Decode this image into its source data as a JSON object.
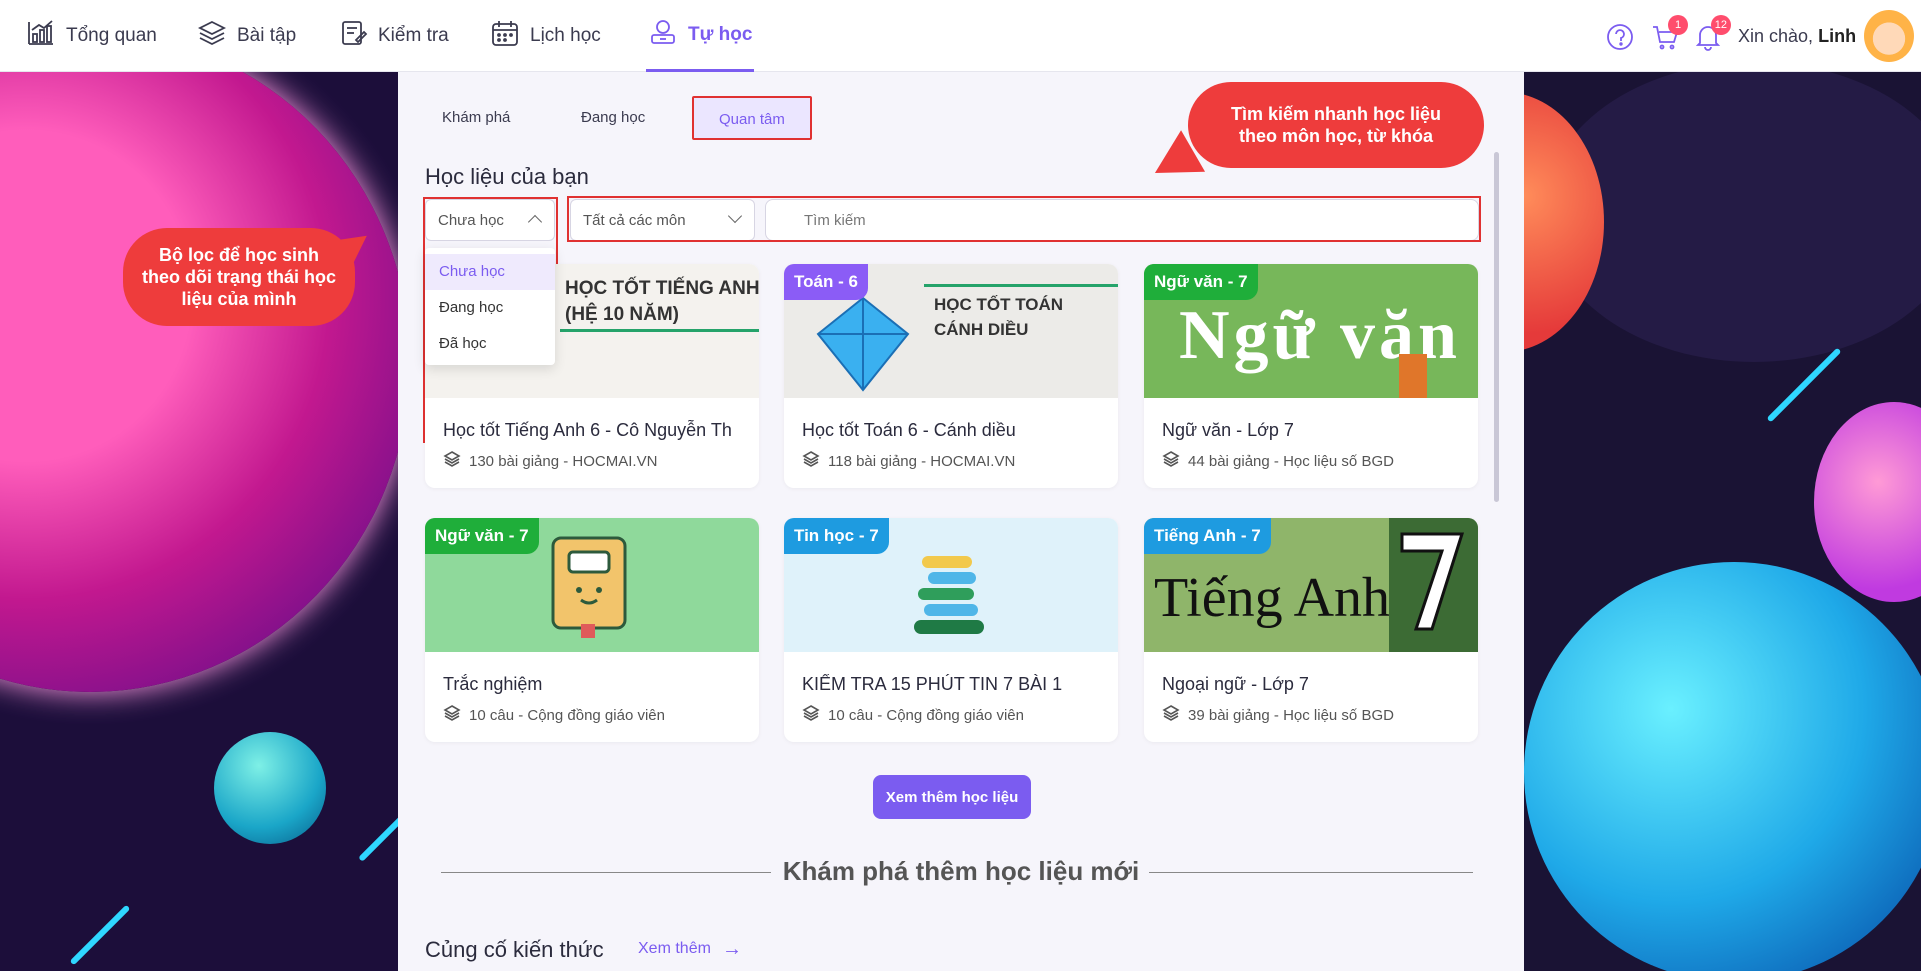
{
  "nav": {
    "items": [
      {
        "label": "Tổng quan",
        "icon": "chart-icon"
      },
      {
        "label": "Bài tập",
        "icon": "layers-icon"
      },
      {
        "label": "Kiểm tra",
        "icon": "test-icon"
      },
      {
        "label": "Lịch học",
        "icon": "calendar-icon"
      },
      {
        "label": "Tự học",
        "icon": "self-study-icon"
      }
    ],
    "active": "Tự học"
  },
  "header": {
    "cart_badge": "1",
    "notification_badge": "12",
    "greeting": "Xin chào,",
    "user_name": "Linh"
  },
  "tabs": [
    "Khám phá",
    "Đang học",
    "Quan tâm"
  ],
  "active_tab": "Quan tâm",
  "section_title": "Học liệu của bạn",
  "filters": {
    "status_value": "Chưa học",
    "subject_value": "Tất cả các môn",
    "search_placeholder": "Tìm kiếm",
    "status_options": [
      "Chưa học",
      "Đang học",
      "Đã học"
    ]
  },
  "cards": [
    {
      "tag": "",
      "tag_color": "",
      "thumb_text": "HỌC TỐT TIẾNG ANH\n(HỆ 10 NĂM)",
      "title": "Học tốt Tiếng Anh 6 - Cô Nguyễn Th",
      "meta": "130 bài giảng - HOCMAI.VN"
    },
    {
      "tag": "Toán - 6",
      "tag_color": "#8b5cf6",
      "thumb_text": "HỌC TỐT TOÁN\nCÁNH DIỀU",
      "title": "Học tốt Toán 6 - Cánh diều",
      "meta": "118 bài giảng - HOCMAI.VN"
    },
    {
      "tag": "Ngữ văn - 7",
      "tag_color": "#1fae3a",
      "thumb_text": "Ngữ văn",
      "title": "Ngữ văn - Lớp 7",
      "meta": "44 bài giảng - Học liệu số BGD"
    },
    {
      "tag": "Ngữ văn - 7",
      "tag_color": "#1fae3a",
      "thumb_text": "",
      "title": "Trắc nghiệm",
      "meta": "10 câu - Cộng đồng giáo viên"
    },
    {
      "tag": "Tin học - 7",
      "tag_color": "#1e9be0",
      "thumb_text": "",
      "title": "KIỂM TRA 15 PHÚT TIN 7 BÀI 1",
      "meta": "10 câu - Cộng đồng giáo viên"
    },
    {
      "tag": "Tiếng Anh - 7",
      "tag_color": "#1e9be0",
      "thumb_text": "Tiếng Anh",
      "title": "Ngoại ngữ - Lớp 7",
      "meta": "39 bài giảng - Học liệu số BGD"
    }
  ],
  "more_button": "Xem thêm học liệu",
  "explore_title": "Khám phá thêm học liệu mới",
  "subsection": {
    "title": "Củng cố kiến thức",
    "see_more": "Xem thêm"
  },
  "callouts": {
    "filter_note": "Bộ lọc để học sinh theo dõi trạng thái học liệu của mình",
    "search_note": "Tìm kiếm nhanh học liệu theo môn học, từ khóa"
  },
  "colors": {
    "accent": "#7b5cf0",
    "highlight": "#e03131",
    "callout": "#ee3c3c"
  }
}
